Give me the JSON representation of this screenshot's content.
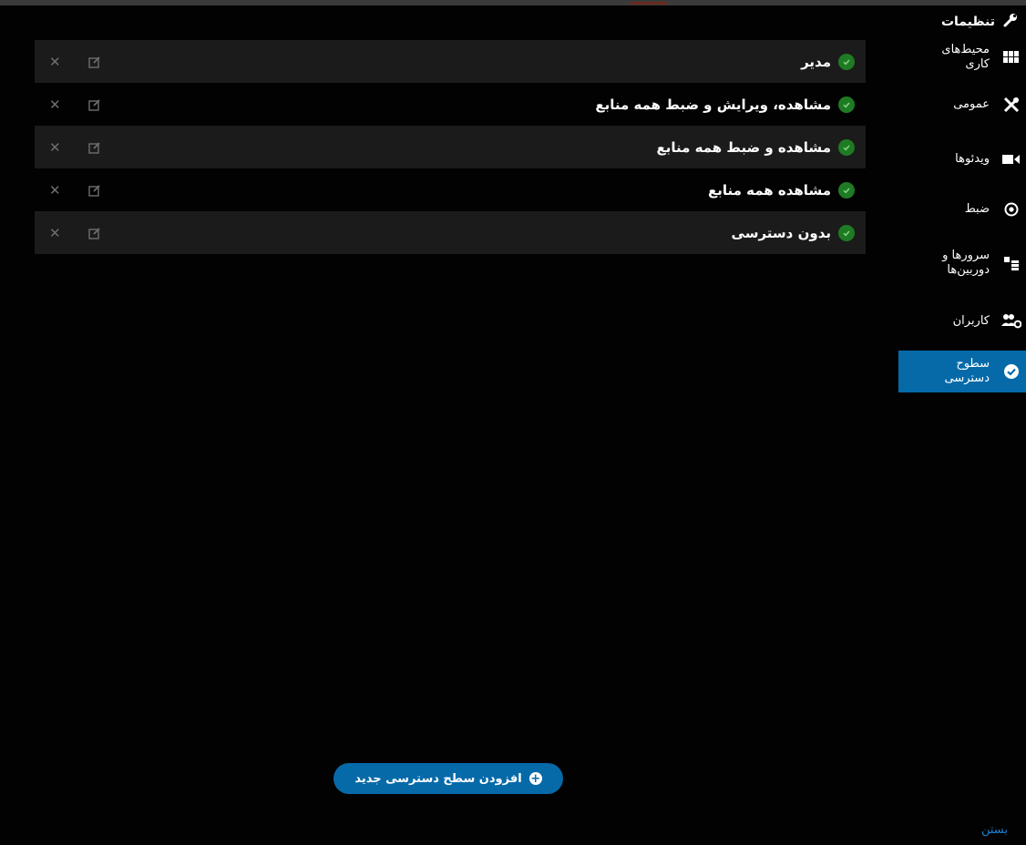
{
  "colors": {
    "accent": "#066aa9",
    "check": "#1f7a24",
    "row_alt": "#1b1b1b",
    "link": "#1b7fd0"
  },
  "sidebar": {
    "title": "تنظیمات",
    "title_icon": "wrench-icon",
    "items": [
      {
        "label": "محیط‌های کاری",
        "icon": "grid-icon"
      },
      {
        "label": "عمومی",
        "icon": "tools-icon"
      },
      {
        "label": "ویدئوها",
        "icon": "video-camera-icon"
      },
      {
        "label": "ضبط",
        "icon": "record-icon"
      },
      {
        "label": "سرورها و دوربین‌ها",
        "icon": "server-camera-icon"
      },
      {
        "label": "کاربران",
        "icon": "users-icon"
      },
      {
        "label": "سطوح دسترسی",
        "icon": "check-circle-icon",
        "active": true
      }
    ]
  },
  "levels": [
    {
      "name": "مدیر"
    },
    {
      "name": "مشاهده، ویرایش و ضبط همه منابع"
    },
    {
      "name": "مشاهده و ضبط همه منابع"
    },
    {
      "name": "مشاهده همه منابع"
    },
    {
      "name": "بدون دسترسی"
    }
  ],
  "row_actions": {
    "delete_icon": "close-icon",
    "edit_icon": "edit-icon"
  },
  "footer": {
    "add_label": "افزودن سطح دسترسی جدید",
    "close_label": "بستن"
  }
}
